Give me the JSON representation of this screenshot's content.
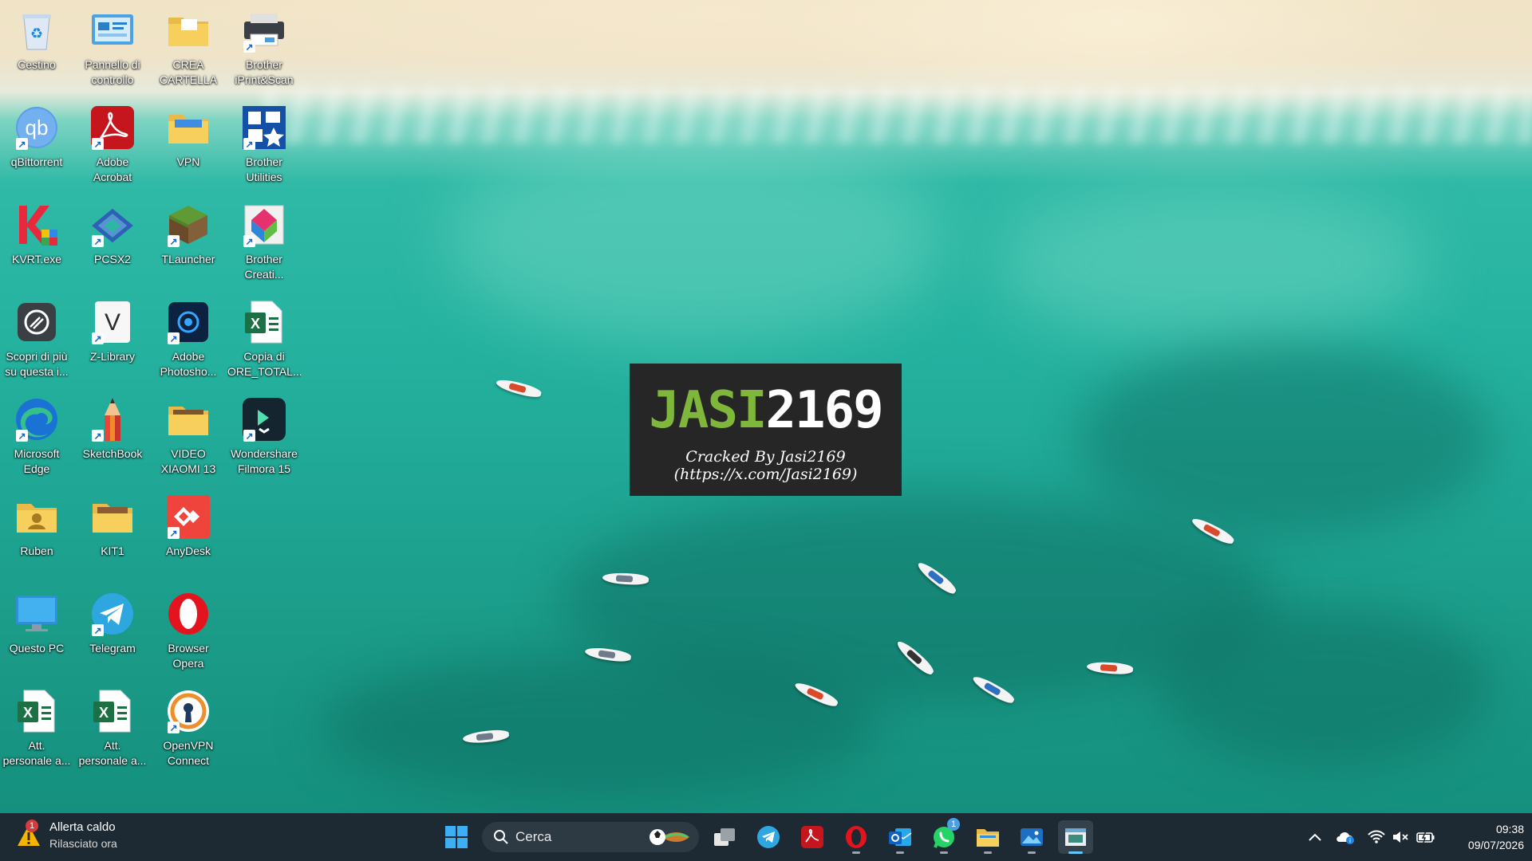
{
  "desktop": {
    "icons": [
      {
        "label": "Cestino",
        "icon": "recycle-bin-icon"
      },
      {
        "label": "Pannello di\ncontrollo",
        "icon": "control-panel-icon"
      },
      {
        "label": "CREA\nCARTELLA",
        "icon": "folder-icon"
      },
      {
        "label": "Brother\niPrint&Scan",
        "icon": "printer-icon"
      },
      {
        "label": "qBittorrent",
        "icon": "qbittorrent-icon"
      },
      {
        "label": "Adobe\nAcrobat",
        "icon": "adobe-acrobat-icon"
      },
      {
        "label": "VPN",
        "icon": "folder-icon"
      },
      {
        "label": "Brother\nUtilities",
        "icon": "brother-utilities-icon"
      },
      {
        "label": "KVRT.exe",
        "icon": "kaspersky-icon"
      },
      {
        "label": "PCSX2",
        "icon": "pcsx2-icon"
      },
      {
        "label": "TLauncher",
        "icon": "minecraft-grass-block-icon"
      },
      {
        "label": "Brother\nCreati...",
        "icon": "brother-creative-center-icon"
      },
      {
        "label": "Scopri di più\nsu questa i...",
        "icon": "camera-icon"
      },
      {
        "label": "Z-Library",
        "icon": "z-library-icon"
      },
      {
        "label": "Adobe\nPhotosho...",
        "icon": "adobe-photoshop-icon"
      },
      {
        "label": "Copia di\nORE_TOTAL...",
        "icon": "excel-file-icon"
      },
      {
        "label": "Microsoft\nEdge",
        "icon": "edge-icon"
      },
      {
        "label": "SketchBook",
        "icon": "pencil-icon"
      },
      {
        "label": "VIDEO\nXIAOMI 13",
        "icon": "folder-icon"
      },
      {
        "label": "Wondershare\nFilmora 15",
        "icon": "filmora-icon"
      },
      {
        "label": "Ruben",
        "icon": "user-folder-icon"
      },
      {
        "label": "KIT1",
        "icon": "folder-icon"
      },
      {
        "label": "AnyDesk",
        "icon": "anydesk-icon"
      },
      {
        "label": "Questo PC",
        "icon": "monitor-icon"
      },
      {
        "label": "Telegram",
        "icon": "telegram-icon"
      },
      {
        "label": "Browser\nOpera",
        "icon": "opera-icon"
      },
      {
        "label": "Att.\npersonale a...",
        "icon": "excel-file-icon"
      },
      {
        "label": "Att.\npersonale a...",
        "icon": "excel-file-icon"
      },
      {
        "label": "OpenVPN\nConnect",
        "icon": "openvpn-icon"
      }
    ]
  },
  "overlay": {
    "logo_left": "JASI",
    "logo_right": "2169",
    "line1": "Cracked By Jasi2169",
    "line2": "(https://x.com/Jasi2169)"
  },
  "taskbar": {
    "weather": {
      "title": "Allerta caldo",
      "subtitle": "Rilasciato ora",
      "badge": "1",
      "icon": "warning-icon"
    },
    "search_placeholder": "Cerca",
    "apps": [
      {
        "name": "task-view",
        "icon": "task-view-icon"
      },
      {
        "name": "telegram",
        "icon": "telegram-icon"
      },
      {
        "name": "adobe-acrobat",
        "icon": "adobe-acrobat-icon"
      },
      {
        "name": "opera",
        "icon": "opera-icon"
      },
      {
        "name": "outlook",
        "icon": "outlook-icon"
      },
      {
        "name": "whatsapp",
        "icon": "whatsapp-icon",
        "badge": "1"
      },
      {
        "name": "file-explorer",
        "icon": "folder-icon"
      },
      {
        "name": "photos",
        "icon": "photos-icon"
      },
      {
        "name": "active-window",
        "icon": "window-icon"
      }
    ],
    "clock": {
      "time": "09:38",
      "date": "09/07/2026"
    }
  },
  "colors": {
    "taskbar_bg": "#1e2a33",
    "accent": "#5cc8ff",
    "logo_green": "#7fb73b"
  }
}
